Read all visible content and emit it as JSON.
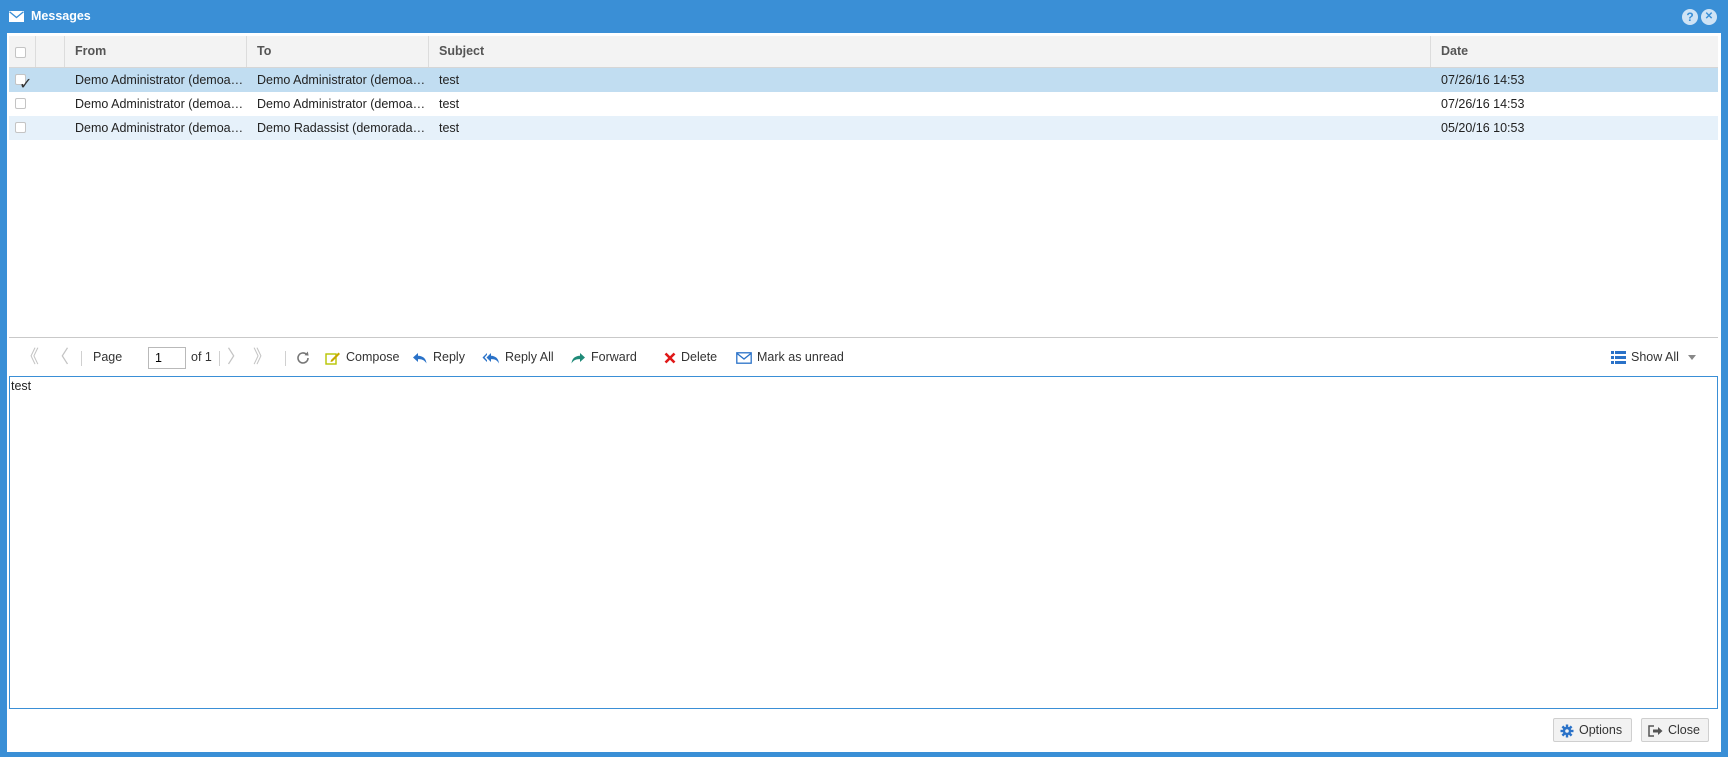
{
  "window": {
    "title": "Messages",
    "help_glyph": "?",
    "close_glyph": "✕",
    "accent": "#3a8fd6"
  },
  "grid": {
    "columns": [
      "From",
      "To",
      "Subject",
      "Date"
    ],
    "rows": [
      {
        "from": "Demo Administrator (demoa…",
        "to": "Demo Administrator (demoa…",
        "subject": "test",
        "date": "07/26/16 14:53",
        "checked": true
      },
      {
        "from": "Demo Administrator (demoa…",
        "to": "Demo Administrator (demoa…",
        "subject": "test",
        "date": "07/26/16 14:53",
        "checked": false
      },
      {
        "from": "Demo Administrator (demoa…",
        "to": "Demo Radassist (demorada…",
        "subject": "test",
        "date": "05/20/16 10:53",
        "checked": false
      }
    ]
  },
  "toolbar": {
    "page_label": "Page",
    "page_value": "1",
    "page_of": "of 1",
    "compose": "Compose",
    "reply": "Reply",
    "reply_all": "Reply All",
    "forward": "Forward",
    "delete": "Delete",
    "mark_unread": "Mark as unread",
    "show_all": "Show All",
    "first_glyph": "《",
    "prev_glyph": "〈",
    "next_glyph": "〉",
    "last_glyph": "》"
  },
  "preview": {
    "body": "test"
  },
  "footer": {
    "options": "Options",
    "close": "Close"
  },
  "icons": [
    "mail-icon",
    "help-icon",
    "close-icon",
    "first-page-icon",
    "prev-page-icon",
    "next-page-icon",
    "last-page-icon",
    "refresh-icon",
    "compose-icon",
    "reply-icon",
    "reply-all-icon",
    "forward-icon",
    "delete-icon",
    "mark-unread-icon",
    "list-icon",
    "gear-icon",
    "sign-out-icon"
  ]
}
